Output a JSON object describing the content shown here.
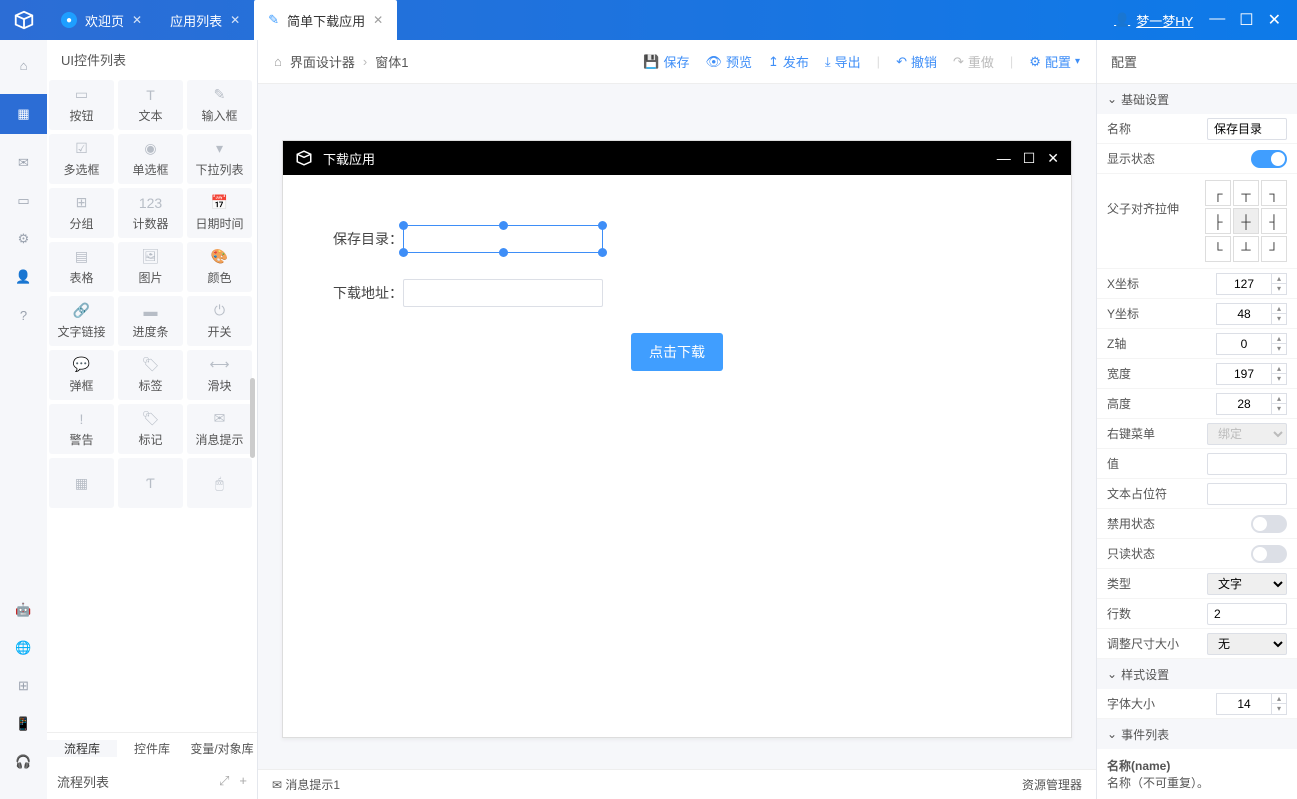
{
  "titlebar": {
    "tabs": [
      {
        "label": "欢迎页",
        "active": false
      },
      {
        "label": "应用列表",
        "active": false
      },
      {
        "label": "简单下载应用",
        "active": true
      }
    ],
    "user": "梦一梦HY"
  },
  "controls_panel": {
    "title": "UI控件列表",
    "items": [
      "按钮",
      "文本",
      "输入框",
      "多选框",
      "单选框",
      "下拉列表",
      "分组",
      "计数器",
      "日期时间",
      "表格",
      "图片",
      "颜色",
      "文字链接",
      "进度条",
      "开关",
      "弹框",
      "标签",
      "滑块",
      "警告",
      "标记",
      "消息提示"
    ],
    "footer_tabs": [
      "流程库",
      "控件库",
      "变量/对象库"
    ],
    "flow_list_label": "流程列表"
  },
  "toolbar": {
    "breadcrumb": [
      "界面设计器",
      "窗体1"
    ],
    "actions": {
      "save": "保存",
      "preview": "预览",
      "publish": "发布",
      "export": "导出",
      "undo": "撤销",
      "redo": "重做",
      "config": "配置"
    }
  },
  "canvas": {
    "window_title": "下载应用",
    "form": {
      "save_dir_label": "保存目录：",
      "download_url_label": "下载地址：",
      "download_btn": "点击下载"
    }
  },
  "bottom": {
    "msg_tip": "消息提示1",
    "res_mgr": "资源管理器"
  },
  "props": {
    "panel_title": "配置",
    "sections": {
      "basic": "基础设置",
      "style": "样式设置",
      "events": "事件列表"
    },
    "fields": {
      "name_label": "名称",
      "name_value": "保存目录",
      "display_label": "显示状态",
      "align_label": "父子对齐拉伸",
      "x_label": "X坐标",
      "x_value": "127",
      "y_label": "Y坐标",
      "y_value": "48",
      "z_label": "Z轴",
      "z_value": "0",
      "width_label": "宽度",
      "width_value": "197",
      "height_label": "高度",
      "height_value": "28",
      "contextmenu_label": "右键菜单",
      "contextmenu_value": "绑定",
      "value_label": "值",
      "placeholder_label": "文本占位符",
      "disabled_label": "禁用状态",
      "readonly_label": "只读状态",
      "type_label": "类型",
      "type_value": "文字",
      "rows_label": "行数",
      "rows_value": "2",
      "resize_label": "调整尺寸大小",
      "resize_value": "无",
      "fontsize_label": "字体大小",
      "fontsize_value": "14"
    },
    "name_desc_title": "名称(name)",
    "name_desc_text": "名称（不可重复）。"
  }
}
